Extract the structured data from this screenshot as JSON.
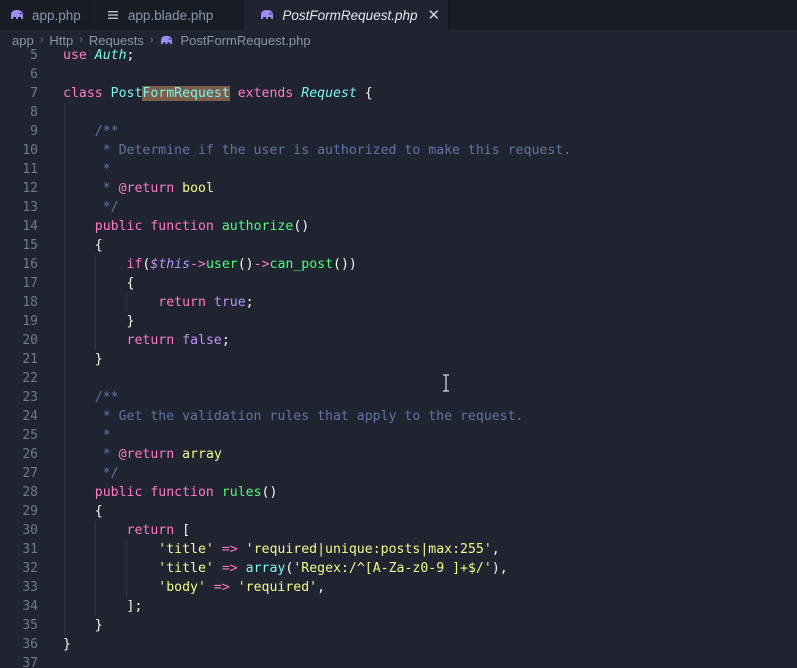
{
  "tabs": [
    {
      "label": "app.php",
      "icon": "php-elephant-icon",
      "active": false
    },
    {
      "label": "app.blade.php",
      "icon": "file-lines-icon",
      "active": false
    },
    {
      "label": "PostFormRequest.php",
      "icon": "php-elephant-icon",
      "active": true
    }
  ],
  "breadcrumb": [
    "app",
    "Http",
    "Requests",
    "PostFormRequest.php"
  ],
  "close_glyph": "✕",
  "crumb_sep": "›",
  "lines": [
    {
      "n": "5",
      "indent": 0,
      "tokens": [
        [
          "kw",
          "use"
        ],
        [
          "plain",
          " "
        ],
        [
          "cls-i",
          "Auth"
        ],
        [
          "plain",
          ";"
        ]
      ]
    },
    {
      "n": "6",
      "indent": 0,
      "tokens": []
    },
    {
      "n": "7",
      "indent": 0,
      "tokens": [
        [
          "kw",
          "class"
        ],
        [
          "plain",
          " "
        ],
        [
          "cls",
          "Post"
        ],
        [
          "cls hl",
          "FormRequest"
        ],
        [
          "plain",
          " "
        ],
        [
          "kw",
          "extends"
        ],
        [
          "plain",
          " "
        ],
        [
          "cls-i",
          "Request"
        ],
        [
          "plain",
          " {"
        ]
      ]
    },
    {
      "n": "8",
      "indent": 1,
      "tokens": []
    },
    {
      "n": "9",
      "indent": 1,
      "tokens": [
        [
          "plain",
          "    "
        ],
        [
          "cmt",
          "/**"
        ]
      ]
    },
    {
      "n": "10",
      "indent": 1,
      "tokens": [
        [
          "plain",
          "    "
        ],
        [
          "cmt",
          " * Determine if the user is authorized to make this request."
        ]
      ]
    },
    {
      "n": "11",
      "indent": 1,
      "tokens": [
        [
          "plain",
          "    "
        ],
        [
          "cmt",
          " *"
        ]
      ]
    },
    {
      "n": "12",
      "indent": 1,
      "tokens": [
        [
          "plain",
          "    "
        ],
        [
          "cmt",
          " * "
        ],
        [
          "ann",
          "@return"
        ],
        [
          "plain",
          " "
        ],
        [
          "str",
          "bool"
        ]
      ]
    },
    {
      "n": "13",
      "indent": 1,
      "tokens": [
        [
          "plain",
          "    "
        ],
        [
          "cmt",
          " */"
        ]
      ]
    },
    {
      "n": "14",
      "indent": 1,
      "tokens": [
        [
          "plain",
          "    "
        ],
        [
          "kw",
          "public"
        ],
        [
          "plain",
          " "
        ],
        [
          "kw",
          "function"
        ],
        [
          "plain",
          " "
        ],
        [
          "fn",
          "authorize"
        ],
        [
          "plain",
          "()"
        ]
      ]
    },
    {
      "n": "15",
      "indent": 1,
      "tokens": [
        [
          "plain",
          "    {"
        ]
      ]
    },
    {
      "n": "16",
      "indent": 2,
      "tokens": [
        [
          "plain",
          "        "
        ],
        [
          "kw",
          "if"
        ],
        [
          "plain",
          "("
        ],
        [
          "var",
          "$this"
        ],
        [
          "op",
          "->"
        ],
        [
          "fn",
          "user"
        ],
        [
          "plain",
          "()"
        ],
        [
          "op",
          "->"
        ],
        [
          "fn",
          "can_post"
        ],
        [
          "plain",
          "())"
        ]
      ]
    },
    {
      "n": "17",
      "indent": 2,
      "tokens": [
        [
          "plain",
          "        {"
        ]
      ]
    },
    {
      "n": "18",
      "indent": 3,
      "tokens": [
        [
          "plain",
          "            "
        ],
        [
          "kw",
          "return"
        ],
        [
          "plain",
          " "
        ],
        [
          "bool",
          "true"
        ],
        [
          "plain",
          ";"
        ]
      ]
    },
    {
      "n": "19",
      "indent": 2,
      "tokens": [
        [
          "plain",
          "        }"
        ]
      ]
    },
    {
      "n": "20",
      "indent": 2,
      "tokens": [
        [
          "plain",
          "        "
        ],
        [
          "kw",
          "return"
        ],
        [
          "plain",
          " "
        ],
        [
          "bool",
          "false"
        ],
        [
          "plain",
          ";"
        ]
      ]
    },
    {
      "n": "21",
      "indent": 1,
      "tokens": [
        [
          "plain",
          "    }"
        ]
      ]
    },
    {
      "n": "22",
      "indent": 1,
      "tokens": []
    },
    {
      "n": "23",
      "indent": 1,
      "tokens": [
        [
          "plain",
          "    "
        ],
        [
          "cmt",
          "/**"
        ]
      ]
    },
    {
      "n": "24",
      "indent": 1,
      "tokens": [
        [
          "plain",
          "    "
        ],
        [
          "cmt",
          " * Get the validation rules that apply to the request."
        ]
      ]
    },
    {
      "n": "25",
      "indent": 1,
      "tokens": [
        [
          "plain",
          "    "
        ],
        [
          "cmt",
          " *"
        ]
      ]
    },
    {
      "n": "26",
      "indent": 1,
      "tokens": [
        [
          "plain",
          "    "
        ],
        [
          "cmt",
          " * "
        ],
        [
          "ann",
          "@return"
        ],
        [
          "plain",
          " "
        ],
        [
          "str",
          "array"
        ]
      ]
    },
    {
      "n": "27",
      "indent": 1,
      "tokens": [
        [
          "plain",
          "    "
        ],
        [
          "cmt",
          " */"
        ]
      ]
    },
    {
      "n": "28",
      "indent": 1,
      "tokens": [
        [
          "plain",
          "    "
        ],
        [
          "kw",
          "public"
        ],
        [
          "plain",
          " "
        ],
        [
          "kw",
          "function"
        ],
        [
          "plain",
          " "
        ],
        [
          "fn",
          "rules"
        ],
        [
          "plain",
          "()"
        ]
      ]
    },
    {
      "n": "29",
      "indent": 1,
      "tokens": [
        [
          "plain",
          "    {"
        ]
      ]
    },
    {
      "n": "30",
      "indent": 2,
      "tokens": [
        [
          "plain",
          "        "
        ],
        [
          "kw",
          "return"
        ],
        [
          "plain",
          " ["
        ]
      ]
    },
    {
      "n": "31",
      "indent": 3,
      "tokens": [
        [
          "plain",
          "            "
        ],
        [
          "str",
          "'title'"
        ],
        [
          "plain",
          " "
        ],
        [
          "op",
          "=>"
        ],
        [
          "plain",
          " "
        ],
        [
          "str",
          "'required|unique:posts|max:255'"
        ],
        [
          "plain",
          ","
        ]
      ]
    },
    {
      "n": "32",
      "indent": 3,
      "tokens": [
        [
          "plain",
          "            "
        ],
        [
          "str",
          "'title'"
        ],
        [
          "plain",
          " "
        ],
        [
          "op",
          "=>"
        ],
        [
          "plain",
          " "
        ],
        [
          "cls",
          "array"
        ],
        [
          "plain",
          "("
        ],
        [
          "str",
          "'Regex:/^[A-Za-z0-9 ]+$/'"
        ],
        [
          "plain",
          "),"
        ]
      ]
    },
    {
      "n": "33",
      "indent": 3,
      "tokens": [
        [
          "plain",
          "            "
        ],
        [
          "str",
          "'body'"
        ],
        [
          "plain",
          " "
        ],
        [
          "op",
          "=>"
        ],
        [
          "plain",
          " "
        ],
        [
          "str",
          "'required'"
        ],
        [
          "plain",
          ","
        ]
      ]
    },
    {
      "n": "34",
      "indent": 2,
      "tokens": [
        [
          "plain",
          "        ];"
        ]
      ]
    },
    {
      "n": "35",
      "indent": 1,
      "tokens": [
        [
          "plain",
          "    }"
        ]
      ]
    },
    {
      "n": "36",
      "indent": 0,
      "tokens": [
        [
          "plain",
          "}"
        ]
      ]
    },
    {
      "n": "37",
      "indent": 0,
      "tokens": []
    }
  ]
}
